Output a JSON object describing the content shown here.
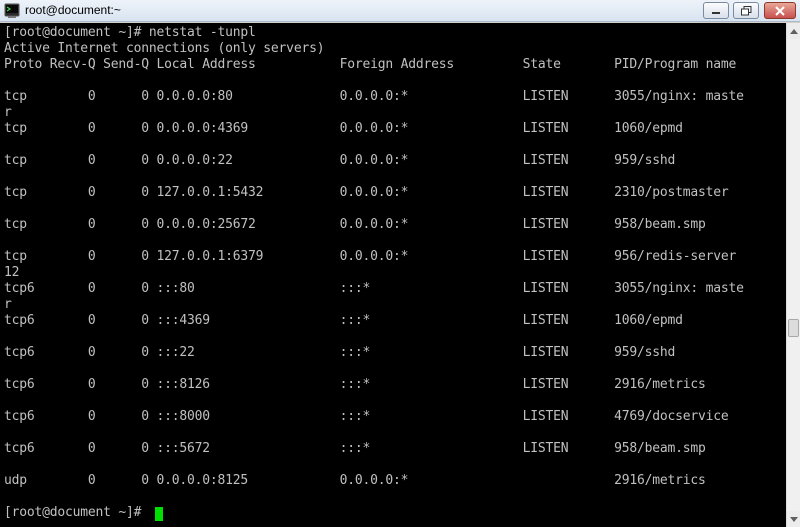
{
  "window": {
    "title": "root@document:~"
  },
  "terminal": {
    "command_line": "[root@document ~]# netstat -tunpl",
    "header1": "Active Internet connections (only servers)",
    "header2": "Proto Recv-Q Send-Q Local Address           Foreign Address         State       PID/Program name",
    "rows": [
      "tcp        0      0 0.0.0.0:80              0.0.0.0:*               LISTEN      3055/nginx: maste",
      "r",
      "tcp        0      0 0.0.0.0:4369            0.0.0.0:*               LISTEN      1060/epmd",
      "tcp        0      0 0.0.0.0:22              0.0.0.0:*               LISTEN      959/sshd",
      "tcp        0      0 127.0.0.1:5432          0.0.0.0:*               LISTEN      2310/postmaster",
      "tcp        0      0 0.0.0.0:25672           0.0.0.0:*               LISTEN      958/beam.smp",
      "tcp        0      0 127.0.0.1:6379          0.0.0.0:*               LISTEN      956/redis-server",
      "12",
      "tcp6       0      0 :::80                   :::*                    LISTEN      3055/nginx: maste",
      "r",
      "tcp6       0      0 :::4369                 :::*                    LISTEN      1060/epmd",
      "tcp6       0      0 :::22                   :::*                    LISTEN      959/sshd",
      "tcp6       0      0 :::8126                 :::*                    LISTEN      2916/metrics",
      "tcp6       0      0 :::8000                 :::*                    LISTEN      4769/docservice",
      "tcp6       0      0 :::5672                 :::*                    LISTEN      958/beam.smp",
      "udp        0      0 0.0.0.0:8125            0.0.0.0:*                           2916/metrics"
    ],
    "prompt": "[root@document ~]# ",
    "cursor_color": "#00e000"
  }
}
